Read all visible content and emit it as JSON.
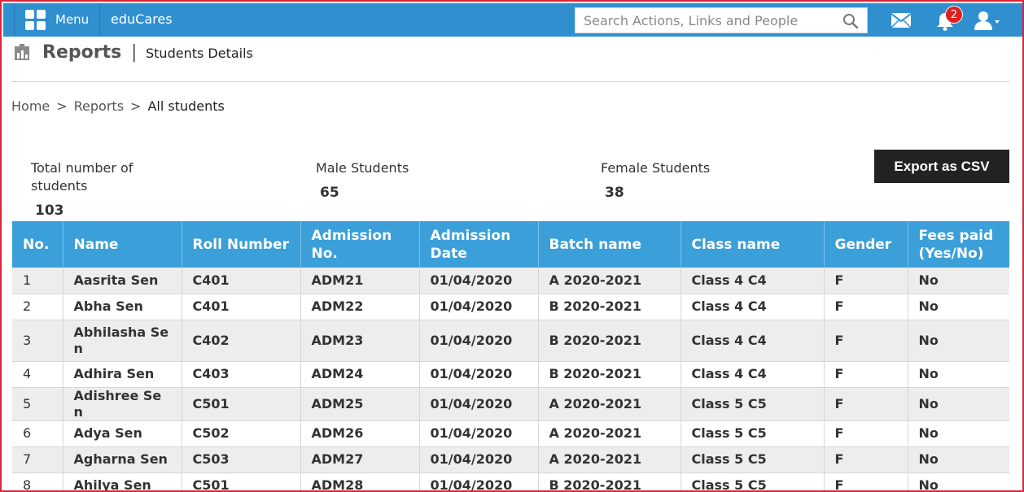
{
  "topbar": {
    "menu_label": "Menu",
    "brand": "eduCares",
    "search_placeholder": "Search Actions, Links and People",
    "notification_count": "2"
  },
  "header": {
    "title": "Reports",
    "separator": "|",
    "subtitle": "Students Details"
  },
  "breadcrumb": {
    "items": [
      "Home",
      "Reports",
      "All students"
    ],
    "separator": ">"
  },
  "stats": {
    "total_label": "Total number of students",
    "total_value": "103",
    "male_label": "Male Students",
    "male_value": "65",
    "female_label": "Female Students",
    "female_value": "38"
  },
  "actions": {
    "export_label": "Export as CSV"
  },
  "table": {
    "columns": [
      "No.",
      "Name",
      "Roll Number",
      "Admission No.",
      "Admission Date",
      "Batch name",
      "Class name",
      "Gender",
      "Fees paid (Yes/No)"
    ],
    "rows": [
      [
        "1",
        "Aasrita Sen",
        "C401",
        "ADM21",
        "01/04/2020",
        "A 2020-2021",
        "Class 4 C4",
        "F",
        "No"
      ],
      [
        "2",
        "Abha Sen",
        "C401",
        "ADM22",
        "01/04/2020",
        "B 2020-2021",
        "Class 4 C4",
        "F",
        "No"
      ],
      [
        "3",
        "Abhilasha Sen",
        "C402",
        "ADM23",
        "01/04/2020",
        "B 2020-2021",
        "Class 4 C4",
        "F",
        "No"
      ],
      [
        "4",
        "Adhira Sen",
        "C403",
        "ADM24",
        "01/04/2020",
        "B 2020-2021",
        "Class 4 C4",
        "F",
        "No"
      ],
      [
        "5",
        "Adishree Sen",
        "C501",
        "ADM25",
        "01/04/2020",
        "A 2020-2021",
        "Class 5 C5",
        "F",
        "No"
      ],
      [
        "6",
        "Adya Sen",
        "C502",
        "ADM26",
        "01/04/2020",
        "A 2020-2021",
        "Class 5 C5",
        "F",
        "No"
      ],
      [
        "7",
        "Agharna Sen",
        "C503",
        "ADM27",
        "01/04/2020",
        "A 2020-2021",
        "Class 5 C5",
        "F",
        "No"
      ],
      [
        "8",
        "Ahilya Sen",
        "C501",
        "ADM28",
        "01/04/2020",
        "B 2020-2021",
        "Class 5 C5",
        "F",
        "No"
      ]
    ]
  },
  "colors": {
    "topbar": "#2f8fcf",
    "table_header": "#3b9fd9",
    "export_button": "#222222",
    "badge": "#e02020",
    "frame_border": "#d9263a"
  }
}
